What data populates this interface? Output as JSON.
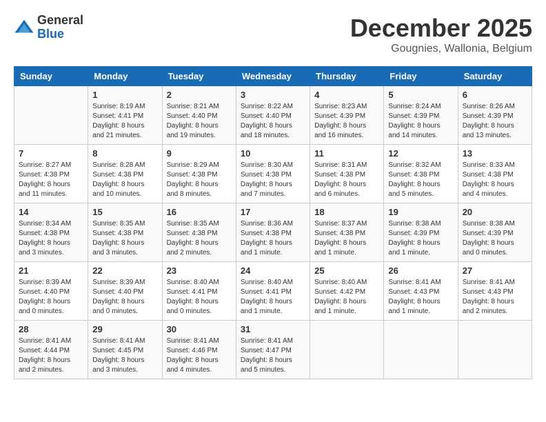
{
  "logo": {
    "general": "General",
    "blue": "Blue"
  },
  "header": {
    "month": "December 2025",
    "location": "Gougnies, Wallonia, Belgium"
  },
  "weekdays": [
    "Sunday",
    "Monday",
    "Tuesday",
    "Wednesday",
    "Thursday",
    "Friday",
    "Saturday"
  ],
  "weeks": [
    [
      {
        "day": "",
        "content": ""
      },
      {
        "day": "1",
        "content": "Sunrise: 8:19 AM\nSunset: 4:41 PM\nDaylight: 8 hours\nand 21 minutes."
      },
      {
        "day": "2",
        "content": "Sunrise: 8:21 AM\nSunset: 4:40 PM\nDaylight: 8 hours\nand 19 minutes."
      },
      {
        "day": "3",
        "content": "Sunrise: 8:22 AM\nSunset: 4:40 PM\nDaylight: 8 hours\nand 18 minutes."
      },
      {
        "day": "4",
        "content": "Sunrise: 8:23 AM\nSunset: 4:39 PM\nDaylight: 8 hours\nand 16 minutes."
      },
      {
        "day": "5",
        "content": "Sunrise: 8:24 AM\nSunset: 4:39 PM\nDaylight: 8 hours\nand 14 minutes."
      },
      {
        "day": "6",
        "content": "Sunrise: 8:26 AM\nSunset: 4:39 PM\nDaylight: 8 hours\nand 13 minutes."
      }
    ],
    [
      {
        "day": "7",
        "content": "Sunrise: 8:27 AM\nSunset: 4:38 PM\nDaylight: 8 hours\nand 11 minutes."
      },
      {
        "day": "8",
        "content": "Sunrise: 8:28 AM\nSunset: 4:38 PM\nDaylight: 8 hours\nand 10 minutes."
      },
      {
        "day": "9",
        "content": "Sunrise: 8:29 AM\nSunset: 4:38 PM\nDaylight: 8 hours\nand 8 minutes."
      },
      {
        "day": "10",
        "content": "Sunrise: 8:30 AM\nSunset: 4:38 PM\nDaylight: 8 hours\nand 7 minutes."
      },
      {
        "day": "11",
        "content": "Sunrise: 8:31 AM\nSunset: 4:38 PM\nDaylight: 8 hours\nand 6 minutes."
      },
      {
        "day": "12",
        "content": "Sunrise: 8:32 AM\nSunset: 4:38 PM\nDaylight: 8 hours\nand 5 minutes."
      },
      {
        "day": "13",
        "content": "Sunrise: 8:33 AM\nSunset: 4:38 PM\nDaylight: 8 hours\nand 4 minutes."
      }
    ],
    [
      {
        "day": "14",
        "content": "Sunrise: 8:34 AM\nSunset: 4:38 PM\nDaylight: 8 hours\nand 3 minutes."
      },
      {
        "day": "15",
        "content": "Sunrise: 8:35 AM\nSunset: 4:38 PM\nDaylight: 8 hours\nand 3 minutes."
      },
      {
        "day": "16",
        "content": "Sunrise: 8:35 AM\nSunset: 4:38 PM\nDaylight: 8 hours\nand 2 minutes."
      },
      {
        "day": "17",
        "content": "Sunrise: 8:36 AM\nSunset: 4:38 PM\nDaylight: 8 hours\nand 1 minute."
      },
      {
        "day": "18",
        "content": "Sunrise: 8:37 AM\nSunset: 4:38 PM\nDaylight: 8 hours\nand 1 minute."
      },
      {
        "day": "19",
        "content": "Sunrise: 8:38 AM\nSunset: 4:39 PM\nDaylight: 8 hours\nand 1 minute."
      },
      {
        "day": "20",
        "content": "Sunrise: 8:38 AM\nSunset: 4:39 PM\nDaylight: 8 hours\nand 0 minutes."
      }
    ],
    [
      {
        "day": "21",
        "content": "Sunrise: 8:39 AM\nSunset: 4:40 PM\nDaylight: 8 hours\nand 0 minutes."
      },
      {
        "day": "22",
        "content": "Sunrise: 8:39 AM\nSunset: 4:40 PM\nDaylight: 8 hours\nand 0 minutes."
      },
      {
        "day": "23",
        "content": "Sunrise: 8:40 AM\nSunset: 4:41 PM\nDaylight: 8 hours\nand 0 minutes."
      },
      {
        "day": "24",
        "content": "Sunrise: 8:40 AM\nSunset: 4:41 PM\nDaylight: 8 hours\nand 1 minute."
      },
      {
        "day": "25",
        "content": "Sunrise: 8:40 AM\nSunset: 4:42 PM\nDaylight: 8 hours\nand 1 minute."
      },
      {
        "day": "26",
        "content": "Sunrise: 8:41 AM\nSunset: 4:43 PM\nDaylight: 8 hours\nand 1 minute."
      },
      {
        "day": "27",
        "content": "Sunrise: 8:41 AM\nSunset: 4:43 PM\nDaylight: 8 hours\nand 2 minutes."
      }
    ],
    [
      {
        "day": "28",
        "content": "Sunrise: 8:41 AM\nSunset: 4:44 PM\nDaylight: 8 hours\nand 2 minutes."
      },
      {
        "day": "29",
        "content": "Sunrise: 8:41 AM\nSunset: 4:45 PM\nDaylight: 8 hours\nand 3 minutes."
      },
      {
        "day": "30",
        "content": "Sunrise: 8:41 AM\nSunset: 4:46 PM\nDaylight: 8 hours\nand 4 minutes."
      },
      {
        "day": "31",
        "content": "Sunrise: 8:41 AM\nSunset: 4:47 PM\nDaylight: 8 hours\nand 5 minutes."
      },
      {
        "day": "",
        "content": ""
      },
      {
        "day": "",
        "content": ""
      },
      {
        "day": "",
        "content": ""
      }
    ]
  ]
}
